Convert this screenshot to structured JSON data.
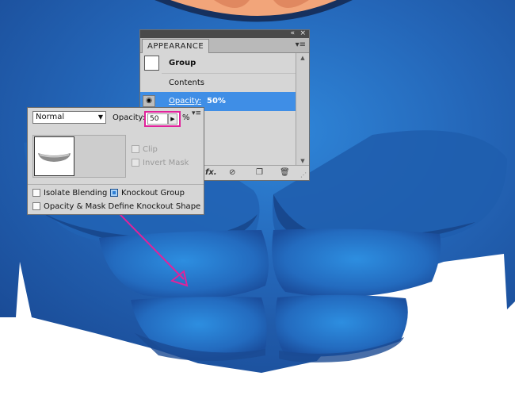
{
  "appearance_panel": {
    "tab_label": "APPEARANCE",
    "collapse_glyph": "«",
    "close_glyph": "×",
    "menu_glyph": "▾≡",
    "rows": {
      "group": {
        "label": "Group"
      },
      "contents": {
        "label": "Contents"
      },
      "opacity": {
        "label": "Opacity:",
        "value": "50%"
      }
    },
    "footer_icons": [
      "fx-icon",
      "clear-appearance-icon",
      "duplicate-item-icon",
      "delete-item-icon"
    ]
  },
  "transparency_panel": {
    "blend_mode": "Normal",
    "opacity_label": "Opacity:",
    "opacity_value": "50",
    "opacity_unit": "%",
    "checkboxes": {
      "clip": {
        "label": "Clip",
        "checked": false,
        "enabled": false
      },
      "invert_mask": {
        "label": "Invert Mask",
        "checked": false,
        "enabled": false
      },
      "isolate_blending": {
        "label": "Isolate Blending",
        "checked": false
      },
      "knockout_group": {
        "label": "Knockout Group",
        "checked": true
      },
      "opacity_mask_knockout": {
        "label": "Opacity & Mask Define Knockout Shape",
        "checked": false
      }
    }
  },
  "colors": {
    "highlight": "#e0239a",
    "selection": "#3f8ee6",
    "body_blue": "#2a6fc0"
  }
}
